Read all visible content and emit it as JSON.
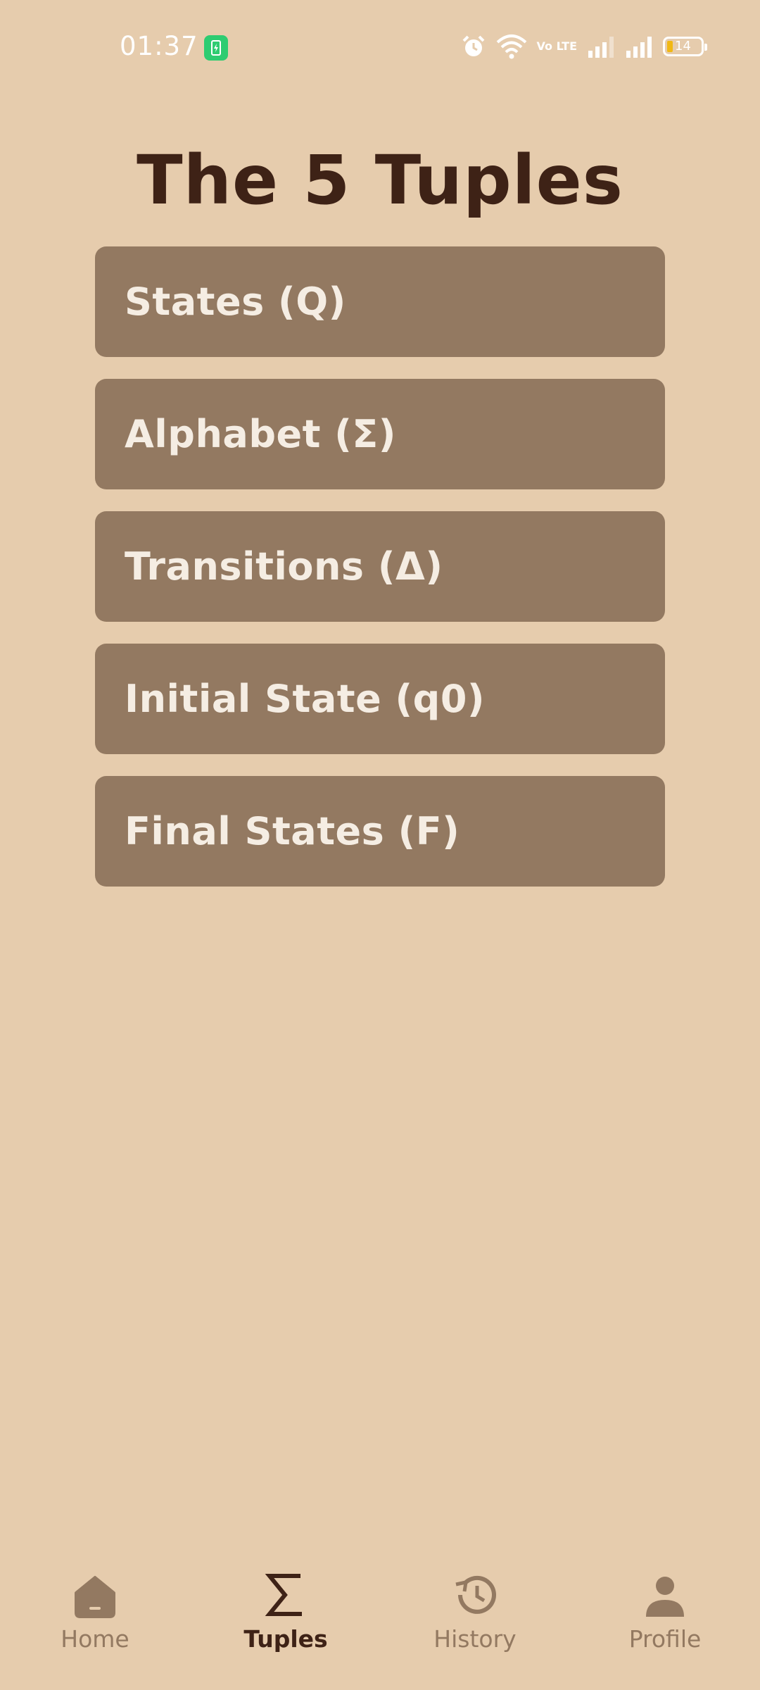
{
  "status_bar": {
    "time": "01:37",
    "battery_percent": "14",
    "network_label": "Vo LTE"
  },
  "page": {
    "title": "The 5 Tuples"
  },
  "tuples": [
    {
      "label": "States (Q)"
    },
    {
      "label": "Alphabet (Σ)"
    },
    {
      "label": "Transitions (Δ)"
    },
    {
      "label": "Initial State (q0)"
    },
    {
      "label": "Final States (F)"
    }
  ],
  "nav": {
    "items": [
      {
        "label": "Home",
        "icon": "home-icon",
        "active": false
      },
      {
        "label": "Tuples",
        "icon": "sigma-icon",
        "active": true
      },
      {
        "label": "History",
        "icon": "history-icon",
        "active": false
      },
      {
        "label": "Profile",
        "icon": "person-icon",
        "active": false
      }
    ]
  },
  "colors": {
    "background": "#E6CCAD",
    "card": "#937961",
    "title": "#3E2216",
    "card_text": "#F5EDE3",
    "nav_inactive": "#937961",
    "nav_active": "#3E2216"
  }
}
